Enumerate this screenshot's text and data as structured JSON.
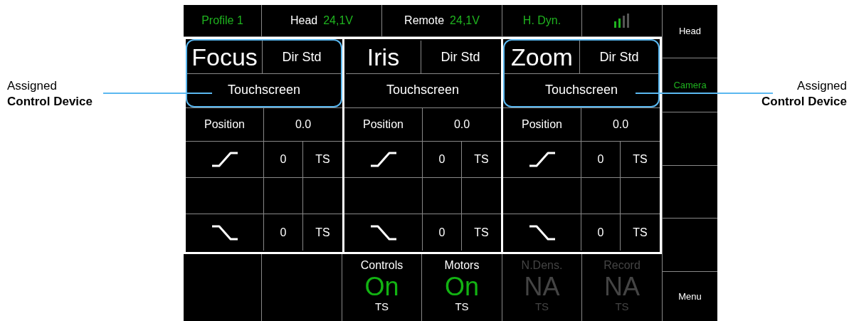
{
  "annotations": [
    {
      "text": "Assigned\n**Control Device**"
    },
    {
      "text": "Assigned\n**Control Device**"
    }
  ],
  "top_bar": [
    {
      "kind": "profile",
      "label": "Profile 1"
    },
    {
      "kind": "voltage",
      "label": "Head",
      "value": "24,1V"
    },
    {
      "kind": "voltage",
      "label": "Remote",
      "value": "24,1V"
    },
    {
      "kind": "profile",
      "label": "H. Dyn."
    },
    {
      "kind": "signal"
    }
  ],
  "panels": [
    {
      "name": "Focus",
      "direction": "Dir Std",
      "device": "Touchscreen",
      "highlighted": true,
      "position_label": "Position",
      "position_value": "0.0",
      "ramps": [
        {
          "kind": "up",
          "value": "0",
          "source": "TS"
        },
        {
          "kind": "empty"
        },
        {
          "kind": "down",
          "value": "0",
          "source": "TS"
        }
      ]
    },
    {
      "name": "Iris",
      "direction": "Dir Std",
      "device": "Touchscreen",
      "highlighted": false,
      "position_label": "Position",
      "position_value": "0.0",
      "ramps": [
        {
          "kind": "up",
          "value": "0",
          "source": "TS"
        },
        {
          "kind": "empty"
        },
        {
          "kind": "down",
          "value": "0",
          "source": "TS"
        }
      ]
    },
    {
      "name": "Zoom",
      "direction": "Dir Std",
      "device": "Touchscreen",
      "highlighted": true,
      "position_label": "Position",
      "position_value": "0.0",
      "ramps": [
        {
          "kind": "up",
          "value": "0",
          "source": "TS"
        },
        {
          "kind": "empty"
        },
        {
          "kind": "down",
          "value": "0",
          "source": "TS"
        }
      ]
    }
  ],
  "status": [
    {
      "kind": "empty"
    },
    {
      "kind": "empty"
    },
    {
      "kind": "status",
      "label": "Controls",
      "value": "On",
      "source": "TS",
      "disabled": false
    },
    {
      "kind": "status",
      "label": "Motors",
      "value": "On",
      "source": "TS",
      "disabled": false
    },
    {
      "kind": "status",
      "label": "N.Dens.",
      "value": "NA",
      "source": "TS",
      "disabled": true
    },
    {
      "kind": "status",
      "label": "Record",
      "value": "NA",
      "source": "TS",
      "disabled": true
    }
  ],
  "side_menu": [
    {
      "kind": "button",
      "label": "Head",
      "selected": false
    },
    {
      "kind": "button",
      "label": "Camera",
      "selected": true
    },
    {
      "kind": "empty"
    },
    {
      "kind": "empty"
    },
    {
      "kind": "empty"
    },
    {
      "kind": "button",
      "label": "Menu",
      "selected": false
    }
  ]
}
